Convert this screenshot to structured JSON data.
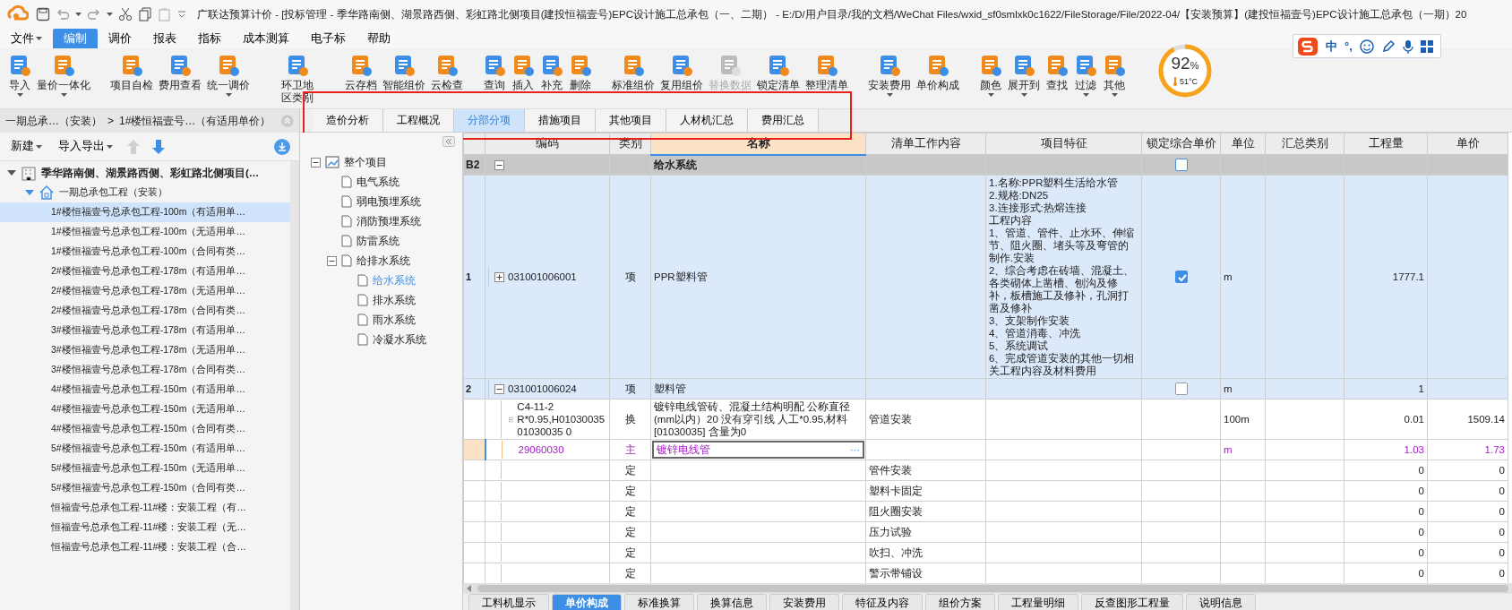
{
  "window": {
    "title": "广联达预算计价 - [投标管理 - 季华路南侧、湖景路西侧、彩虹路北侧项目(建投恒福壹号)EPC设计施工总承包（一、二期） - E:/D/用户目录/我的文档/WeChat Files/wxid_sf0smlxk0c1622/FileStorage/File/2022-04/【安装预算】(建投恒福壹号)EPC设计施工总承包（一期）20"
  },
  "menu": [
    {
      "label": "文件",
      "dropdown": true,
      "selected": false
    },
    {
      "label": "编制",
      "dropdown": false,
      "selected": true
    },
    {
      "label": "调价",
      "dropdown": false,
      "selected": false
    },
    {
      "label": "报表",
      "dropdown": false,
      "selected": false
    },
    {
      "label": "指标",
      "dropdown": false,
      "selected": false
    },
    {
      "label": "成本测算",
      "dropdown": false,
      "selected": false
    },
    {
      "label": "电子标",
      "dropdown": false,
      "selected": false
    },
    {
      "label": "帮助",
      "dropdown": false,
      "selected": false
    }
  ],
  "toolbar": [
    [
      {
        "label": "导入",
        "dropdown": true,
        "disabled": false
      },
      {
        "label": "量价一体化",
        "dropdown": true,
        "disabled": false
      }
    ],
    [
      {
        "label": "项目自检",
        "dropdown": false,
        "disabled": false
      },
      {
        "label": "费用查看",
        "dropdown": false,
        "disabled": false
      },
      {
        "label": "统一调价",
        "dropdown": true,
        "disabled": false
      }
    ],
    [
      {
        "label": "环卫地区类别",
        "dropdown": false,
        "disabled": false
      }
    ],
    [
      {
        "label": "云存档",
        "dropdown": false,
        "disabled": false
      },
      {
        "label": "智能组价",
        "dropdown": false,
        "disabled": false
      },
      {
        "label": "云检查",
        "dropdown": false,
        "disabled": false
      }
    ],
    [
      {
        "label": "查询",
        "dropdown": false,
        "disabled": false
      },
      {
        "label": "插入",
        "dropdown": false,
        "disabled": false
      },
      {
        "label": "补充",
        "dropdown": false,
        "disabled": false
      },
      {
        "label": "删除",
        "dropdown": false,
        "disabled": false
      }
    ],
    [
      {
        "label": "标准组价",
        "dropdown": false,
        "disabled": false
      },
      {
        "label": "复用组价",
        "dropdown": false,
        "disabled": false
      },
      {
        "label": "替换数据",
        "dropdown": false,
        "disabled": true
      },
      {
        "label": "锁定清单",
        "dropdown": false,
        "disabled": false
      },
      {
        "label": "整理清单",
        "dropdown": false,
        "disabled": false
      }
    ],
    [
      {
        "label": "安装费用",
        "dropdown": true,
        "disabled": false
      },
      {
        "label": "单价构成",
        "dropdown": false,
        "disabled": false
      }
    ],
    [
      {
        "label": "颜色",
        "dropdown": true,
        "disabled": false
      },
      {
        "label": "展开到",
        "dropdown": true,
        "disabled": false
      },
      {
        "label": "查找",
        "dropdown": false,
        "disabled": false
      },
      {
        "label": "过滤",
        "dropdown": true,
        "disabled": false
      },
      {
        "label": "其他",
        "dropdown": true,
        "disabled": false
      }
    ]
  ],
  "gauge": {
    "value": "92",
    "unit": "%",
    "temperature": "51°C",
    "level": 0.92
  },
  "ime_bar": {
    "items": [
      "中",
      "°,"
    ]
  },
  "breadcrumb": [
    "一期总承…（安装）",
    ">",
    "1#楼恒福壹号…（有适用单价）"
  ],
  "left_toolbar": {
    "buttons": [
      {
        "label": "新建",
        "dropdown": true
      },
      {
        "label": "导入导出",
        "dropdown": true
      }
    ],
    "arrows": [
      {
        "kind": "up",
        "disabled": true
      },
      {
        "kind": "down",
        "disabled": false
      }
    ]
  },
  "project_tree": [
    {
      "kind": "project",
      "label": "季华路南侧、湖景路西侧、彩虹路北侧项目(…",
      "expanded": true,
      "selected": false,
      "children": [
        {
          "kind": "unit",
          "label": "一期总承包工程（安装）",
          "expanded": true,
          "selected": false,
          "children": [
            {
              "label": "1#楼恒福壹号总承包工程-100m（有适用单…",
              "selected": true
            },
            {
              "label": "1#楼恒福壹号总承包工程-100m（无适用单…",
              "selected": false
            },
            {
              "label": "1#楼恒福壹号总承包工程-100m（合同有类…",
              "selected": false
            },
            {
              "label": "2#楼恒福壹号总承包工程-178m（有适用单…",
              "selected": false
            },
            {
              "label": "2#楼恒福壹号总承包工程-178m（无适用单…",
              "selected": false
            },
            {
              "label": "2#楼恒福壹号总承包工程-178m（合同有类…",
              "selected": false
            },
            {
              "label": "3#楼恒福壹号总承包工程-178m（有适用单…",
              "selected": false
            },
            {
              "label": "3#楼恒福壹号总承包工程-178m（无适用单…",
              "selected": false
            },
            {
              "label": "3#楼恒福壹号总承包工程-178m（合同有类…",
              "selected": false
            },
            {
              "label": "4#楼恒福壹号总承包工程-150m（有适用单…",
              "selected": false
            },
            {
              "label": "4#楼恒福壹号总承包工程-150m（无适用单…",
              "selected": false
            },
            {
              "label": "4#楼恒福壹号总承包工程-150m（合同有类…",
              "selected": false
            },
            {
              "label": "5#楼恒福壹号总承包工程-150m（有适用单…",
              "selected": false
            },
            {
              "label": "5#楼恒福壹号总承包工程-150m（无适用单…",
              "selected": false
            },
            {
              "label": "5#楼恒福壹号总承包工程-150m（合同有类…",
              "selected": false
            },
            {
              "label": "恒福壹号总承包工程-11#楼：安装工程（有…",
              "selected": false
            },
            {
              "label": "恒福壹号总承包工程-11#楼：安装工程（无…",
              "selected": false
            },
            {
              "label": "恒福壹号总承包工程-11#楼：安装工程（合…",
              "selected": false
            }
          ]
        }
      ]
    }
  ],
  "tab_bar": {
    "highlighted": true,
    "tabs": [
      {
        "label": "造价分析",
        "selected": false
      },
      {
        "label": "工程概况",
        "selected": false
      },
      {
        "label": "分部分项",
        "selected": true
      },
      {
        "label": "措施项目",
        "selected": false
      },
      {
        "label": "其他项目",
        "selected": false
      },
      {
        "label": "人材机汇总",
        "selected": false
      },
      {
        "label": "费用汇总",
        "selected": false
      }
    ]
  },
  "section_tree": [
    {
      "kind": "root",
      "label": "整个项目",
      "expanded": true,
      "selected": false,
      "children": [
        {
          "kind": "page",
          "label": "电气系统",
          "selected": false
        },
        {
          "kind": "page",
          "label": "弱电预埋系统",
          "selected": false
        },
        {
          "kind": "page",
          "label": "消防预埋系统",
          "selected": false
        },
        {
          "kind": "page",
          "label": "防雷系统",
          "selected": false
        },
        {
          "kind": "page",
          "label": "给排水系统",
          "expanded": true,
          "selected": false,
          "children": [
            {
              "kind": "page",
              "label": "给水系统",
              "selected": true
            },
            {
              "kind": "page",
              "label": "排水系统",
              "selected": false
            },
            {
              "kind": "page",
              "label": "雨水系统",
              "selected": false
            },
            {
              "kind": "page",
              "label": "冷凝水系统",
              "selected": false
            }
          ]
        }
      ]
    }
  ],
  "grid": {
    "columns": [
      {
        "selected": false
      },
      {
        "label": "编码",
        "selected": false
      },
      {
        "label": "类别",
        "selected": false
      },
      {
        "label": "名称",
        "selected": true
      },
      {
        "label": "清单工作内容",
        "selected": false
      },
      {
        "label": "项目特征",
        "selected": false
      },
      {
        "label": "锁定综合单价",
        "selected": false
      },
      {
        "label": "单位",
        "selected": false
      },
      {
        "label": "汇总类别",
        "selected": false
      },
      {
        "label": "工程量",
        "selected": false
      },
      {
        "label": "单价",
        "selected": false
      }
    ],
    "rows": [
      {
        "kind": "section",
        "number": "B2",
        "expanded": true,
        "name": "给水系统",
        "lock": false
      },
      {
        "kind": "item",
        "number": "1",
        "expanded": false,
        "code": "031001006001",
        "type": "项",
        "name": "PPR塑料管",
        "features": [
          "1.名称:PPR塑料生活给水管",
          "2.规格:DN25",
          "3.连接形式:热熔连接",
          "工程内容",
          "1、管道、管件、止水环、伸缩节、阻火圈、堵头等及弯管的制作.安装",
          "2、综合考虑在砖墙、混凝土、各类砌体上凿槽、刨沟及修补，板槽施工及修补，孔洞打凿及修补",
          "3、支架制作安装",
          "4、管道消毒、冲洗",
          "5、系统调试",
          "6、完成管道安装的其他一切相关工程内容及材料费用"
        ],
        "lock": true,
        "unit": "m",
        "qty": "1777.1"
      },
      {
        "kind": "item",
        "number": "2",
        "expanded": true,
        "code": "031001006024",
        "type": "项",
        "name": "塑料管",
        "lock": false,
        "unit": "m",
        "qty": "1"
      },
      {
        "kind": "quota",
        "expanded": true,
        "code": "C4-11-2 R*0.95,H01030035 01030035 0",
        "type": "换",
        "name": "镀锌电线管砖、混凝土结构明配 公称直径(mm以内）20  没有穿引线 人工*0.95,材料[01030035] 含量为0",
        "work": "管道安装",
        "unit": "100m",
        "qty": "0.01",
        "price": "1509.14"
      },
      {
        "kind": "material",
        "focused": true,
        "code": "29060030",
        "type": "主",
        "name": "镀锌电线管",
        "edit_button": "···",
        "unit": "m",
        "qty": "1.03",
        "price": "1.73"
      },
      {
        "kind": "blank",
        "type": "定",
        "work": "管件安装",
        "qty": "0",
        "price": "0"
      },
      {
        "kind": "blank",
        "type": "定",
        "work": "塑料卡固定",
        "qty": "0",
        "price": "0"
      },
      {
        "kind": "blank",
        "type": "定",
        "work": "阻火圈安装",
        "qty": "0",
        "price": "0"
      },
      {
        "kind": "blank",
        "type": "定",
        "work": "压力试验",
        "qty": "0",
        "price": "0"
      },
      {
        "kind": "blank",
        "type": "定",
        "work": "吹扫、冲洗",
        "qty": "0",
        "price": "0"
      },
      {
        "kind": "blank",
        "type": "定",
        "work": "警示带铺设",
        "qty": "0",
        "price": "0"
      }
    ]
  },
  "bottom_tabs": [
    {
      "label": "工料机显示",
      "selected": false
    },
    {
      "label": "单价构成",
      "selected": true
    },
    {
      "label": "标准换算",
      "selected": false
    },
    {
      "label": "换算信息",
      "selected": false
    },
    {
      "label": "安装费用",
      "selected": false
    },
    {
      "label": "特征及内容",
      "selected": false
    },
    {
      "label": "组价方案",
      "selected": false
    },
    {
      "label": "工程量明细",
      "selected": false
    },
    {
      "label": "反查图形工程量",
      "selected": false
    },
    {
      "label": "说明信息",
      "selected": false
    }
  ]
}
